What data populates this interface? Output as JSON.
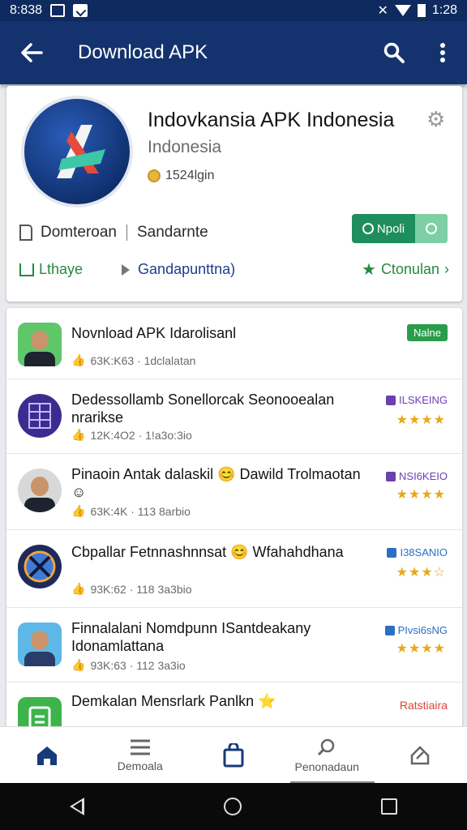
{
  "status_bar": {
    "time_left": "8:838",
    "time_right": "1:28"
  },
  "app_bar": {
    "title": "Download APK",
    "back_icon": "arrow-left-icon",
    "search_icon": "search-icon",
    "menu_icon": "more-vert-icon"
  },
  "app_header": {
    "name": "Indovkansia APK Indonesia",
    "subtitle": "Indonesia",
    "rating_text": "1524lgin",
    "meta_left": "Domteroan",
    "meta_right": "Sandarnte",
    "install_label": "Npoli",
    "link_left": "Lthaye",
    "link_mid": "Gandapunttna)",
    "link_right": "Ctonulan"
  },
  "list": [
    {
      "title": "Novnload APK Idarolisanl",
      "meta": "63K:K63  ·  1dclalatan",
      "badge": "Nalne",
      "badge_type": "green",
      "stars": ""
    },
    {
      "title": "Dedessollamb Sonellorcak Seonooealan nrarikse",
      "meta": "12K:4O2  ·  1!a3o:3io",
      "badge": "ILSKEING",
      "badge_type": "purple",
      "stars": "★★★★"
    },
    {
      "title": "Pinaoin Antak dalaskil 😊 Dawild Trolmaotan ☺",
      "meta": "63K:4K  ·  113 8arbio",
      "badge": "NSI6KEIO",
      "badge_type": "purple",
      "stars": "★★★★"
    },
    {
      "title": "Cbpallar Fetnnashnnsat 😊 Wfahahdhana",
      "meta": "93K:62  ·  118 3a3bio",
      "badge": "I38SANIO",
      "badge_type": "blue",
      "stars": "★★★☆"
    },
    {
      "title": "Finnalalani Nomdpunn ISantdeakany Idonamlattana",
      "meta": "93K:63  ·  112 3a3io",
      "badge": "PIvsi6sNG",
      "badge_type": "blue",
      "stars": "★★★★"
    },
    {
      "title": "Demkalan Mensrlark Panlkn ⭐",
      "meta": "",
      "badge": "Ratstiaira",
      "badge_type": "red",
      "stars": ""
    }
  ],
  "bottom_nav": {
    "downloads": "Demoala",
    "personal": "Penonadaun"
  },
  "colors": {
    "primary": "#14336e",
    "accent_green": "#1e8e5e",
    "star": "#e8a81a"
  }
}
